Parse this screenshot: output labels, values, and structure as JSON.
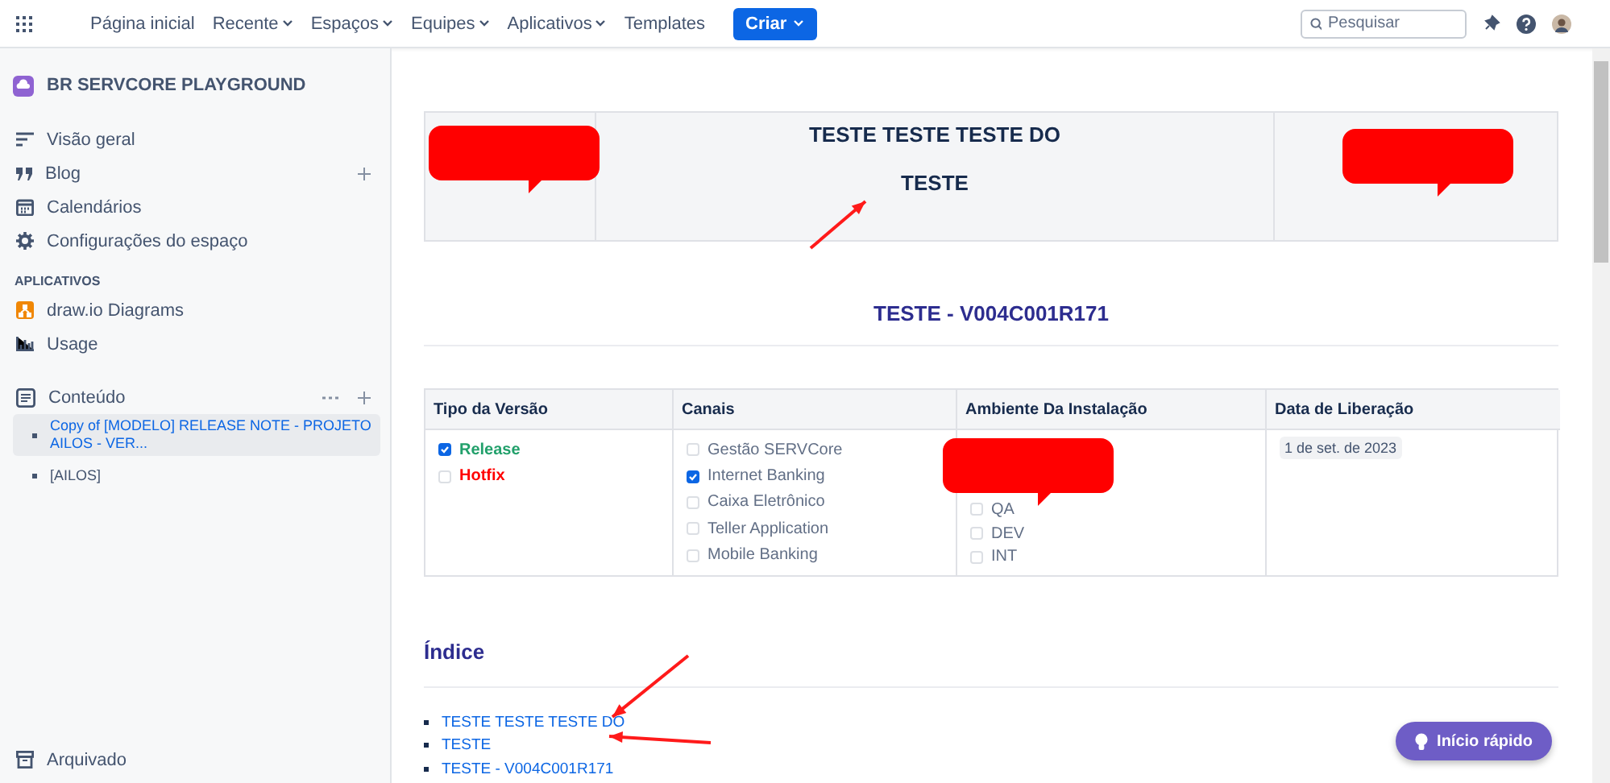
{
  "nav": {
    "items": [
      {
        "label": "Página inicial",
        "dropdown": false
      },
      {
        "label": "Recente",
        "dropdown": true
      },
      {
        "label": "Espaços",
        "dropdown": true
      },
      {
        "label": "Equipes",
        "dropdown": true
      },
      {
        "label": "Aplicativos",
        "dropdown": true
      },
      {
        "label": "Templates",
        "dropdown": false
      }
    ],
    "create_button": "Criar",
    "search": {
      "placeholder": "Pesquisar"
    }
  },
  "sidebar": {
    "space_name": "BR SERVCORE PLAYGROUND",
    "items": [
      {
        "label": "Visão geral",
        "kind": "overview"
      },
      {
        "label": "Blog",
        "kind": "blog"
      },
      {
        "label": "Calendários",
        "kind": "calendar"
      },
      {
        "label": "Configurações do espaço",
        "kind": "settings"
      }
    ],
    "apps_heading": "APLICATIVOS",
    "apps": [
      {
        "label": "draw.io Diagrams",
        "kind": "drawio"
      },
      {
        "label": "Usage",
        "kind": "usage"
      }
    ],
    "content_label": "Conteúdo",
    "pages": [
      {
        "label": "Copy of [MODELO] RELEASE NOTE - PROJETO AILOS - VER...",
        "selected": true
      },
      {
        "label": "[AILOS]",
        "selected": false
      }
    ],
    "archived": "Arquivado"
  },
  "page": {
    "banner_lines": [
      "TESTE TESTE TESTE DO",
      "TESTE"
    ],
    "heading": "TESTE - V004C001R171",
    "table": {
      "columns": [
        "Tipo da Versão",
        "Canais",
        "Ambiente Da Instalação",
        "Data de Liberação"
      ],
      "versions": [
        {
          "label": "Release",
          "checked": true,
          "color": "#22a06b"
        },
        {
          "label": "Hotfix",
          "checked": false,
          "color": "#ff0000"
        }
      ],
      "channels": [
        {
          "label": "Gestão SERVCore",
          "checked": false
        },
        {
          "label": "Internet Banking",
          "checked": true
        },
        {
          "label": "Caixa Eletrônico",
          "checked": false
        },
        {
          "label": "Teller Application",
          "checked": false
        },
        {
          "label": "Mobile Banking",
          "checked": false
        }
      ],
      "environments": [
        {
          "label": "QA",
          "checked": false
        },
        {
          "label": "DEV",
          "checked": false
        },
        {
          "label": "INT",
          "checked": false
        }
      ],
      "release_date": "1 de set. de 2023"
    },
    "index_heading": "Índice",
    "index_links": [
      "TESTE TESTE TESTE DO",
      "TESTE",
      "TESTE - V004C001R171"
    ]
  },
  "quick_start": "Início rápido"
}
